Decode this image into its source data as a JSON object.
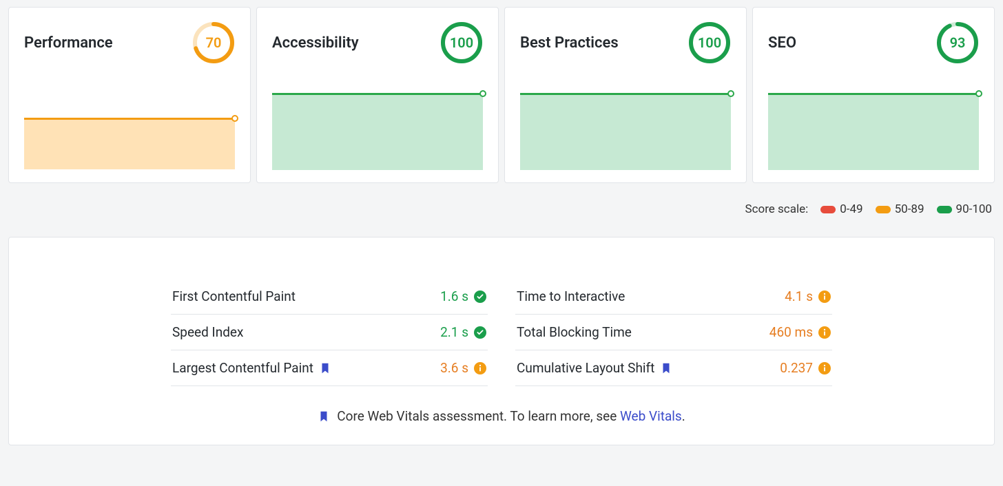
{
  "colors": {
    "red": "#e74c3c",
    "orange": "#f39c12",
    "green": "#1a9e4b",
    "link": "#3b4cca"
  },
  "cards": [
    {
      "title": "Performance",
      "score": 70,
      "status": "orange"
    },
    {
      "title": "Accessibility",
      "score": 100,
      "status": "green"
    },
    {
      "title": "Best Practices",
      "score": 100,
      "status": "green"
    },
    {
      "title": "SEO",
      "score": 93,
      "status": "green"
    }
  ],
  "legend": {
    "label": "Score scale:",
    "ranges": [
      {
        "range": "0-49",
        "color": "#e74c3c"
      },
      {
        "range": "50-89",
        "color": "#f39c12"
      },
      {
        "range": "90-100",
        "color": "#1a9e4b"
      }
    ]
  },
  "metrics": {
    "left": [
      {
        "label": "First Contentful Paint",
        "value": "1.6 s",
        "status": "green",
        "vital": false
      },
      {
        "label": "Speed Index",
        "value": "2.1 s",
        "status": "green",
        "vital": false
      },
      {
        "label": "Largest Contentful Paint",
        "value": "3.6 s",
        "status": "orange",
        "vital": true
      }
    ],
    "right": [
      {
        "label": "Time to Interactive",
        "value": "4.1 s",
        "status": "orange",
        "vital": false
      },
      {
        "label": "Total Blocking Time",
        "value": "460 ms",
        "status": "orange",
        "vital": false
      },
      {
        "label": "Cumulative Layout Shift",
        "value": "0.237",
        "status": "orange",
        "vital": true
      }
    ]
  },
  "footnote": {
    "prefix": "Core Web Vitals assessment. To learn more, see ",
    "link_text": "Web Vitals",
    "suffix": "."
  }
}
